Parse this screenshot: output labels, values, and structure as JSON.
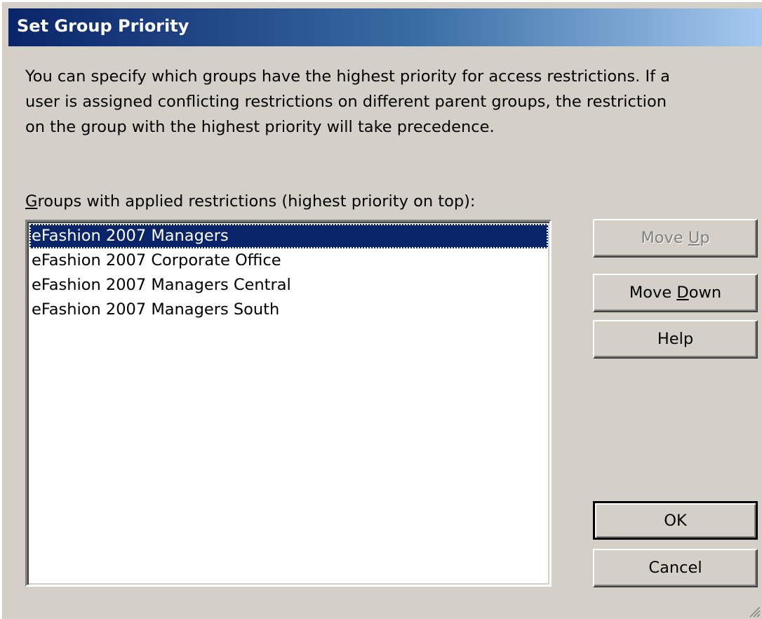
{
  "window": {
    "title": "Set Group Priority"
  },
  "description": "You can specify which groups have the highest priority for access restrictions.  If a\nuser is assigned conflicting restrictions on different parent groups, the restriction\non the group with the highest priority will take precedence.",
  "groups_label": {
    "mnemonic": "G",
    "rest": "roups with applied restrictions (highest priority on top):"
  },
  "groups": [
    {
      "label": "eFashion 2007 Managers",
      "selected": true
    },
    {
      "label": "eFashion 2007 Corporate Office",
      "selected": false
    },
    {
      "label": "eFashion 2007 Managers Central",
      "selected": false
    },
    {
      "label": "eFashion 2007 Managers South",
      "selected": false
    }
  ],
  "buttons": {
    "move_up": {
      "before": "Move ",
      "mnemonic": "U",
      "after": "p",
      "enabled": false
    },
    "move_down": {
      "before": "Move ",
      "mnemonic": "D",
      "after": "own",
      "enabled": true
    },
    "help": {
      "label": "Help"
    },
    "ok": {
      "label": "OK",
      "default": true
    },
    "cancel": {
      "label": "Cancel"
    }
  },
  "colors": {
    "face": "#d4d0c8",
    "title_start": "#0a246a",
    "title_end": "#a6caf0",
    "selection": "#0a246a"
  }
}
